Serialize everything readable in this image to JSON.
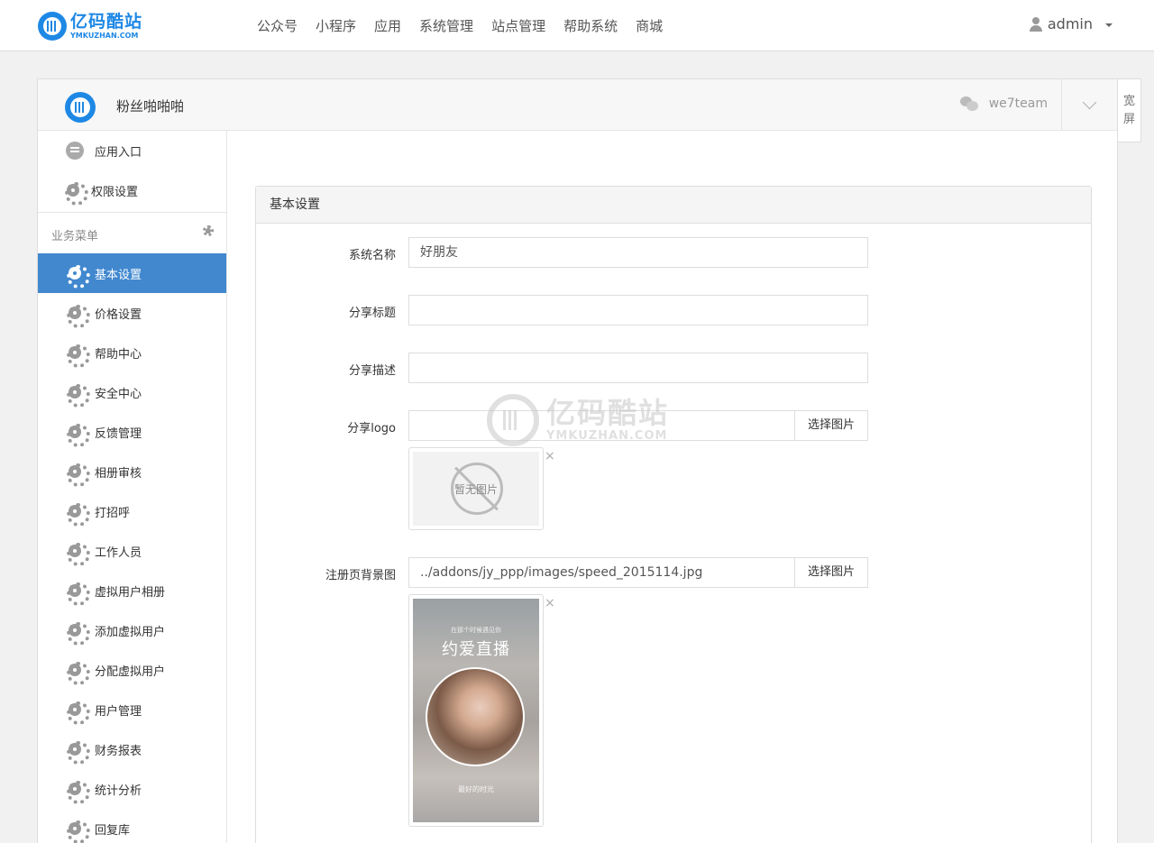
{
  "brand": {
    "name": "亿码酷站",
    "sub": "YMKUZHAN.COM"
  },
  "topnav": {
    "items": [
      "公众号",
      "小程序",
      "应用",
      "系统管理",
      "站点管理",
      "帮助系统",
      "商城"
    ]
  },
  "user": {
    "name": "admin"
  },
  "account": {
    "name": "粉丝啪啪啪",
    "wechat_id": "we7team"
  },
  "wide_toggle": {
    "line1": "宽",
    "line2": "屏"
  },
  "sidebar": {
    "top_items": [
      {
        "label": "应用入口",
        "icon": "chat-icon"
      },
      {
        "label": "权限设置",
        "icon": "gear-icon"
      }
    ],
    "group_title": "业务菜单",
    "menu": [
      {
        "label": "基本设置",
        "active": true
      },
      {
        "label": "价格设置"
      },
      {
        "label": "帮助中心"
      },
      {
        "label": "安全中心"
      },
      {
        "label": "反馈管理"
      },
      {
        "label": "相册审核"
      },
      {
        "label": "打招呼"
      },
      {
        "label": "工作人员"
      },
      {
        "label": "虚拟用户相册"
      },
      {
        "label": "添加虚拟用户"
      },
      {
        "label": "分配虚拟用户"
      },
      {
        "label": "用户管理"
      },
      {
        "label": "财务报表"
      },
      {
        "label": "统计分析"
      },
      {
        "label": "回复库"
      }
    ]
  },
  "form": {
    "title": "基本设置",
    "system_name": {
      "label": "系统名称",
      "value": "好朋友"
    },
    "share_title": {
      "label": "分享标题",
      "value": ""
    },
    "share_desc": {
      "label": "分享描述",
      "value": ""
    },
    "share_logo": {
      "label": "分享logo",
      "value": "",
      "button": "选择图片",
      "placeholder_text": "暂无图片"
    },
    "reg_bg": {
      "label": "注册页背景图",
      "value": "../addons/jy_ppp/images/speed_2015114.jpg",
      "button": "选择图片",
      "image_texts": {
        "top": "在那个时候遇见你",
        "title": "约爱直播",
        "bottom": "最好的时光"
      }
    },
    "remove_mark": "×"
  },
  "watermark": {
    "cn": "亿码酷站",
    "en": "YMKUZHAN.COM"
  }
}
